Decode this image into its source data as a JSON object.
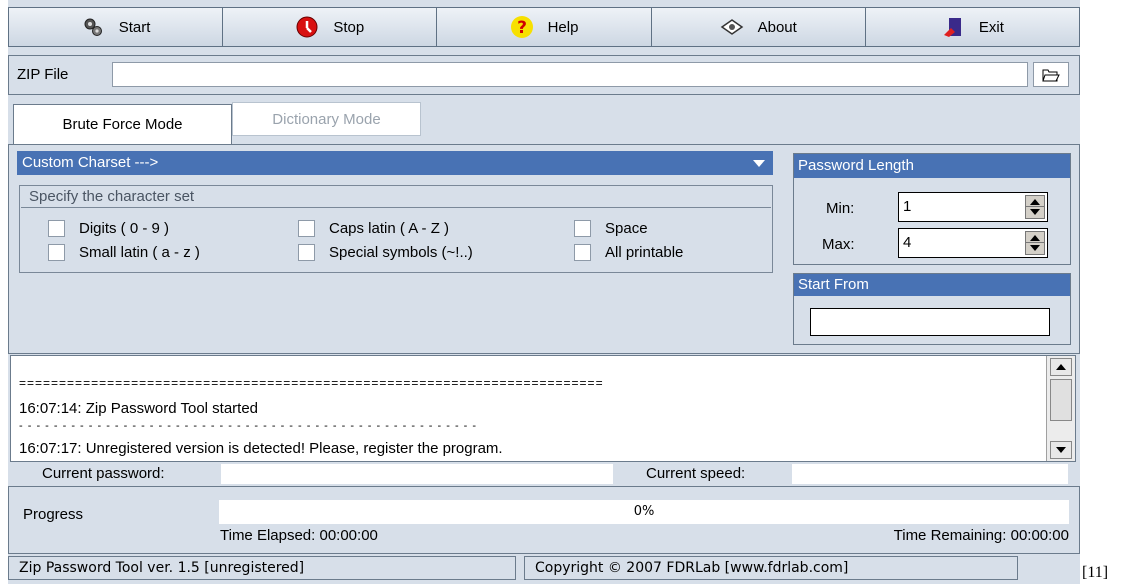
{
  "toolbar": {
    "buttons": [
      {
        "label": "Start",
        "icon": "gears-icon"
      },
      {
        "label": "Stop",
        "icon": "stop-icon"
      },
      {
        "label": "Help",
        "icon": "question-icon"
      },
      {
        "label": "About",
        "icon": "eye-icon"
      },
      {
        "label": "Exit",
        "icon": "exit-door-icon"
      }
    ]
  },
  "zip": {
    "label": "ZIP File",
    "value": ""
  },
  "tabs": [
    {
      "label": "Brute Force Mode",
      "active": true
    },
    {
      "label": "Dictionary Mode",
      "active": false
    }
  ],
  "charset": {
    "dropdown_value": "Custom Charset --->",
    "group_title": "Specify the character set",
    "options": [
      {
        "label": "Digits ( 0 - 9 )",
        "checked": false
      },
      {
        "label": "Caps latin ( A - Z )",
        "checked": false
      },
      {
        "label": "Space",
        "checked": false
      },
      {
        "label": "Small latin ( a - z )",
        "checked": false
      },
      {
        "label": "Special symbols (~!..)",
        "checked": false
      },
      {
        "label": "All printable",
        "checked": false
      }
    ]
  },
  "password_length": {
    "title": "Password Length",
    "min_label": "Min:",
    "min_value": "1",
    "max_label": "Max:",
    "max_value": "4"
  },
  "start_from": {
    "title": "Start From",
    "value": ""
  },
  "log": {
    "separator": "=========================================================================",
    "lines": [
      "16:07:14: Zip Password Tool started",
      "16:07:17: Unregistered version is detected! Please, register the program."
    ],
    "dash_separator": "- - - - - - - - - - - - - - - - - - - - - - - - - - - - - - - - - - - - - - - - - - - - - - - - - - - - -"
  },
  "current": {
    "password_label": "Current password:",
    "password_value": "",
    "speed_label": "Current speed:",
    "speed_value": ""
  },
  "progress": {
    "label": "Progress",
    "percent_text": "0%",
    "fraction": 0,
    "elapsed": "Time Elapsed: 00:00:00",
    "remaining": "Time Remaining: 00:00:00"
  },
  "statusbar": {
    "version": "Zip Password Tool ver. 1.5 [unregistered]",
    "copyright": "Copyright © 2007 FDRLab [www.fdrlab.com]"
  },
  "caption_ref": "[11]",
  "colors": {
    "accent": "#4872b4",
    "background": "#d7dfe9"
  }
}
